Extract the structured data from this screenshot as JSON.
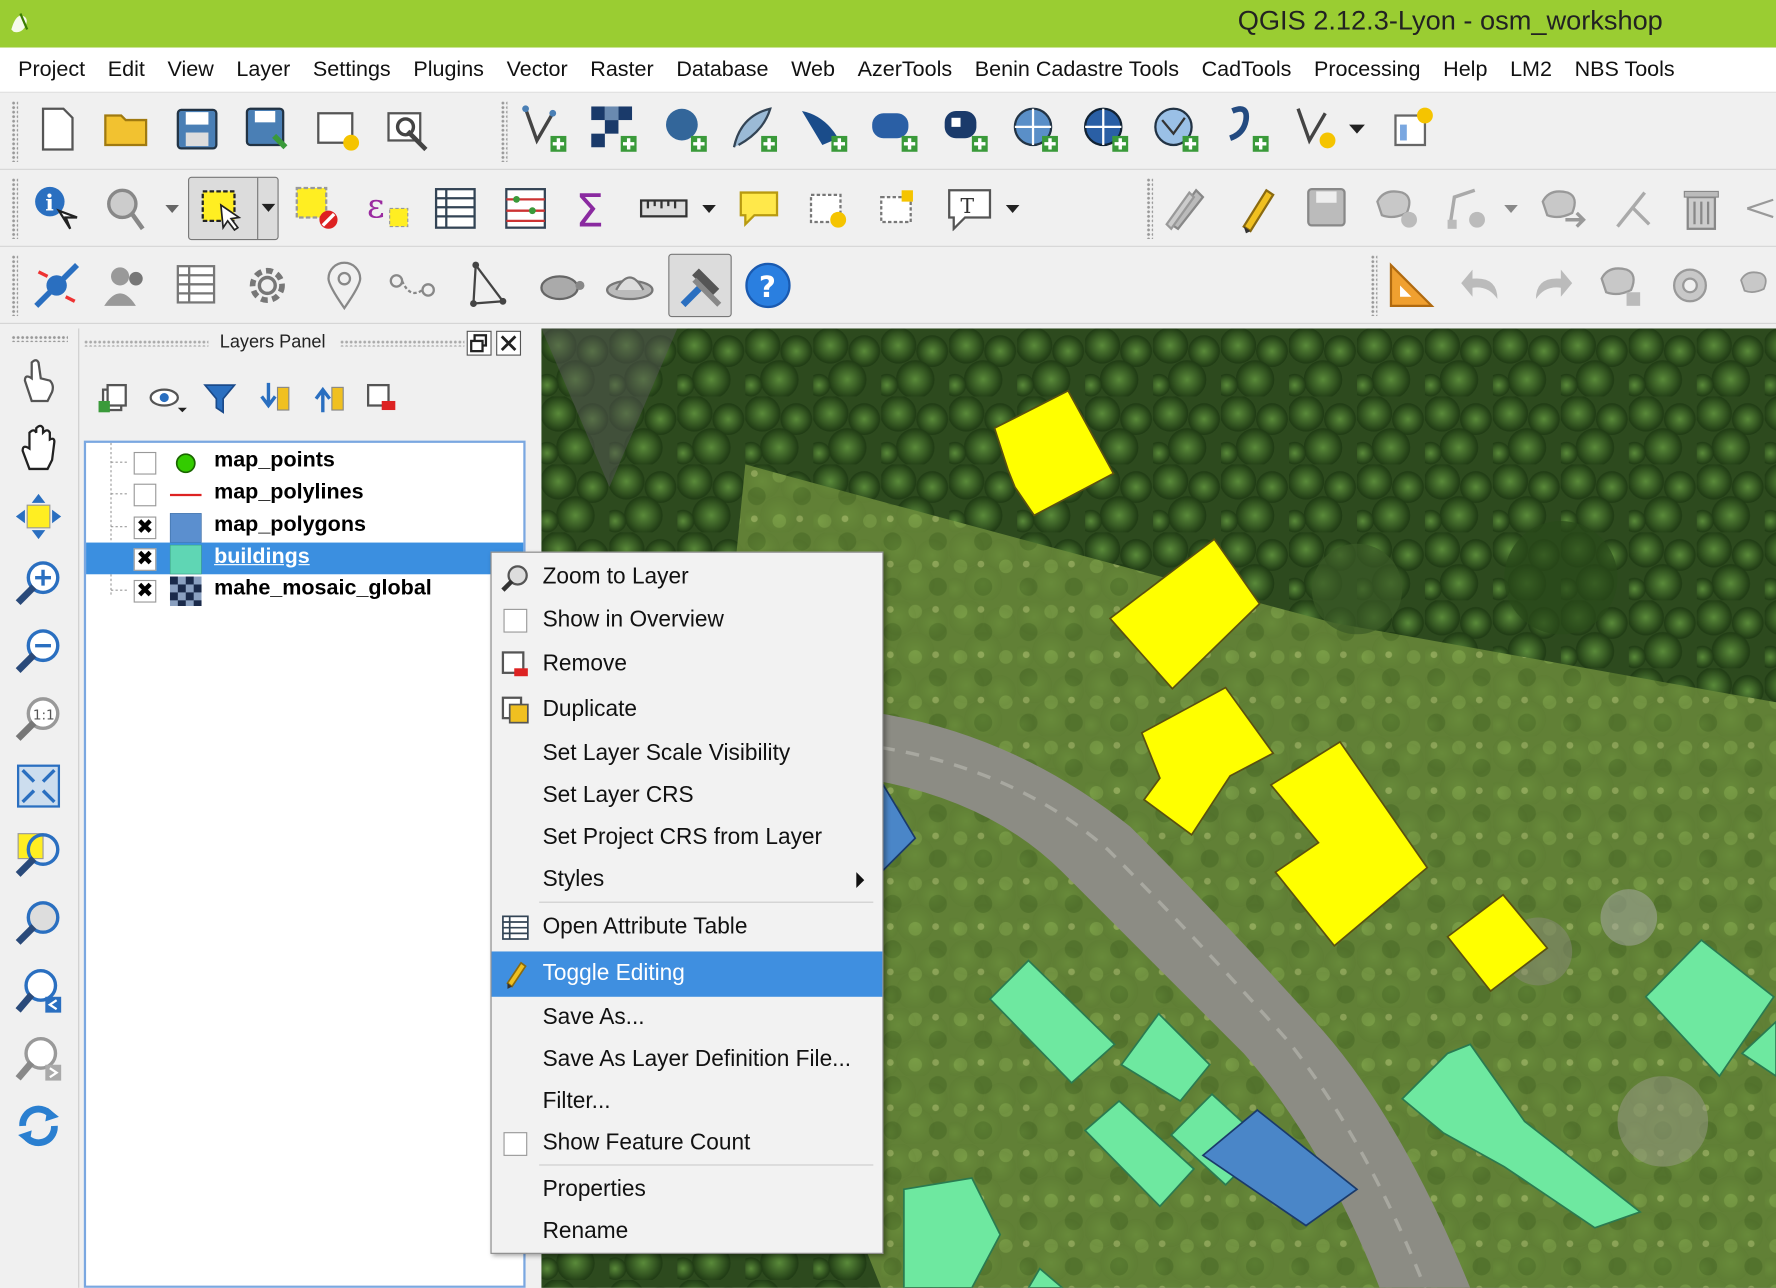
{
  "window": {
    "title": "QGIS 2.12.3-Lyon - osm_workshop"
  },
  "menubar": [
    "Project",
    "Edit",
    "View",
    "Layer",
    "Settings",
    "Plugins",
    "Vector",
    "Raster",
    "Database",
    "Web",
    "AzerTools",
    "Benin Cadastre Tools",
    "CadTools",
    "Processing",
    "Help",
    "LM2",
    "NBS Tools"
  ],
  "layers_panel": {
    "title": "Layers Panel",
    "layers": [
      {
        "name": "map_points",
        "checked": false,
        "color": "#33cc00"
      },
      {
        "name": "map_polylines",
        "checked": false,
        "color": "#dd2222"
      },
      {
        "name": "map_polygons",
        "checked": true,
        "color": "#5b8fcf"
      },
      {
        "name": "buildings",
        "checked": true,
        "color": "#5fd6b4",
        "selected": true
      },
      {
        "name": "mahe_mosaic_global",
        "checked": true,
        "color": "#334466"
      }
    ]
  },
  "context_menu": {
    "items": [
      {
        "label": "Zoom to Layer",
        "icon": "zoom-layer-icon"
      },
      {
        "label": "Show in Overview",
        "icon": "checkbox-icon"
      },
      {
        "label": "Remove",
        "icon": "remove-layer-icon"
      },
      {
        "label": "Duplicate",
        "icon": "duplicate-icon"
      },
      {
        "label": "Set Layer Scale Visibility"
      },
      {
        "label": "Set Layer CRS"
      },
      {
        "label": "Set Project CRS from Layer"
      },
      {
        "label": "Styles",
        "submenu": true
      },
      {
        "label": "Open Attribute Table",
        "icon": "attribute-table-icon"
      },
      {
        "label": "Toggle Editing",
        "icon": "pencil-icon",
        "highlighted": true
      },
      {
        "label": "Save As..."
      },
      {
        "label": "Save As Layer Definition File..."
      },
      {
        "label": "Filter..."
      },
      {
        "label": "Show Feature Count",
        "icon": "checkbox-icon"
      },
      {
        "label": "Properties"
      },
      {
        "label": "Rename"
      }
    ]
  },
  "colors": {
    "titlebar": "#9acd32",
    "highlight": "#3f8fe0",
    "buildings_yellow": "#ffff00",
    "buildings_green": "#6ee8a0",
    "buildings_blue": "#4a86c8"
  }
}
